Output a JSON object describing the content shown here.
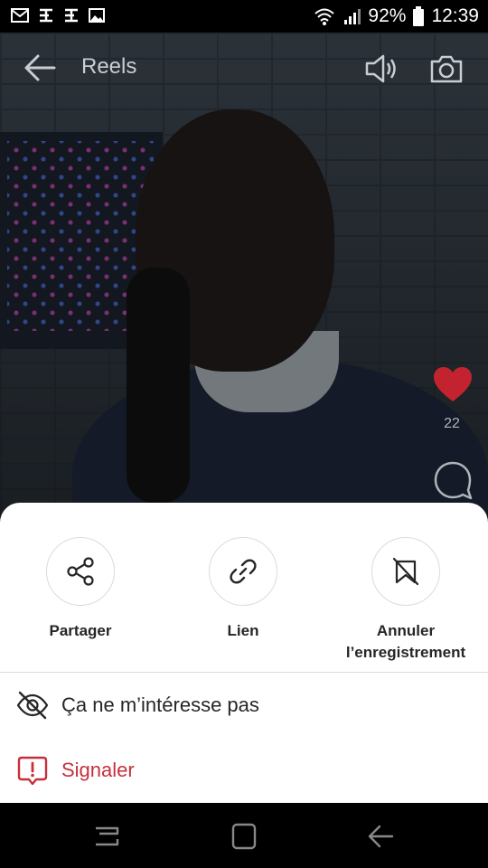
{
  "status_bar": {
    "battery": "92%",
    "time": "12:39"
  },
  "header": {
    "title": "Reels"
  },
  "engagement": {
    "likes": "22"
  },
  "sheet": {
    "actions": [
      {
        "label": "Partager"
      },
      {
        "label": "Lien"
      },
      {
        "label": "Annuler l’enregistrement"
      }
    ],
    "options": [
      {
        "label": "Ça ne m’intéresse pas"
      },
      {
        "label": "Signaler"
      }
    ]
  },
  "colors": {
    "danger": "#c72f3b",
    "heart": "#c2232f",
    "text": "#262626",
    "sheet_bg": "#ffffff"
  }
}
